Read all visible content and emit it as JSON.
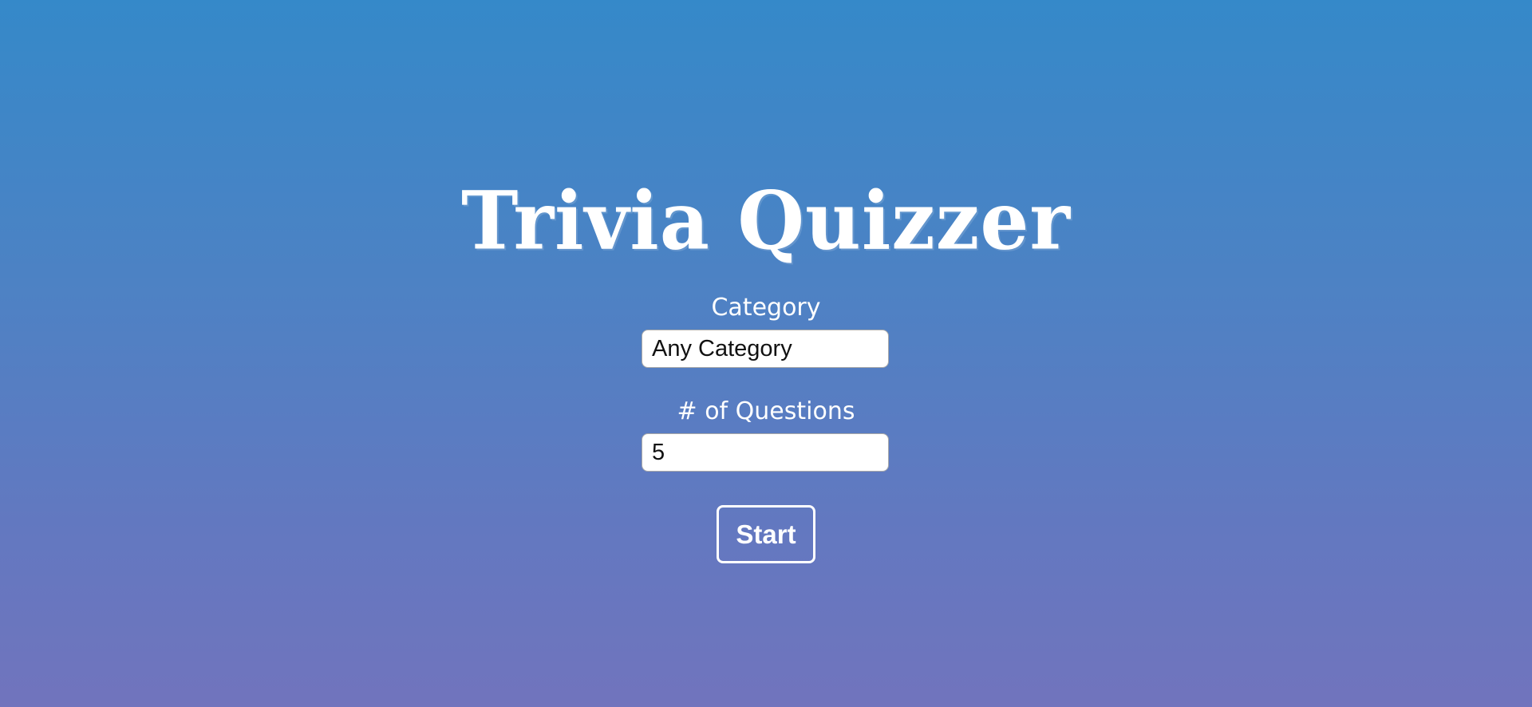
{
  "app": {
    "title": "Trivia Quizzer"
  },
  "form": {
    "category": {
      "label": "Category",
      "value": "Any Category"
    },
    "questions": {
      "label": "# of Questions",
      "value": "5"
    },
    "start_label": "Start"
  },
  "colors": {
    "background_top": "#3589c9",
    "background_bottom": "#7174bd",
    "text": "#ffffff",
    "field_background": "#ffffff",
    "field_text": "#111111"
  }
}
